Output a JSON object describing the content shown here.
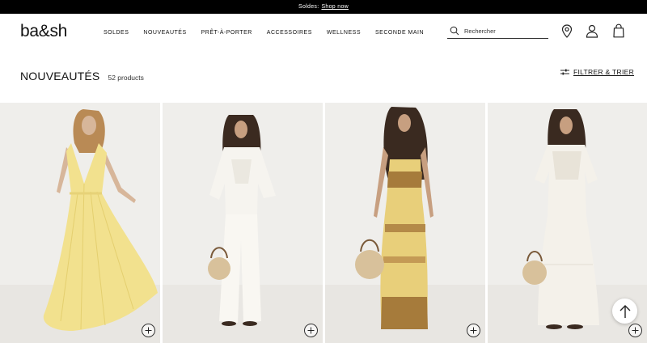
{
  "promo": {
    "text": "Soldes:",
    "link": "Shop now"
  },
  "header": {
    "logo": "ba&sh",
    "nav": [
      "SOLDES",
      "NOUVEAUTÉS",
      "PRÊT-À-PORTER",
      "ACCESSOIRES",
      "WELLNESS",
      "SECONDE MAIN"
    ],
    "search": {
      "placeholder": "Rechercher",
      "icon": "search-icon"
    },
    "icons": [
      "location-pin-icon",
      "account-icon",
      "shopping-bag-icon"
    ]
  },
  "listing": {
    "title": "NOUVEAUTÉS",
    "count": "52 products",
    "filter_label": "FILTRER & TRIER",
    "filter_icon": "sliders-icon"
  },
  "products": [
    {
      "name": "yellow-maxi-dress",
      "dress_color": "#f2e18e",
      "bg_color": "#efedea"
    },
    {
      "name": "white-blouse-wide-pants",
      "dress_color": "#f6f4ef",
      "bg_color": "#efedea"
    },
    {
      "name": "yellow-printed-maxi-dress",
      "dress_color": "#e8cf7a",
      "bg_color": "#efedea"
    },
    {
      "name": "white-embroidered-maxi-dress",
      "dress_color": "#f4f1ea",
      "bg_color": "#efedea"
    }
  ],
  "colors": {
    "promo_bg": "#000000",
    "text": "#111111"
  }
}
